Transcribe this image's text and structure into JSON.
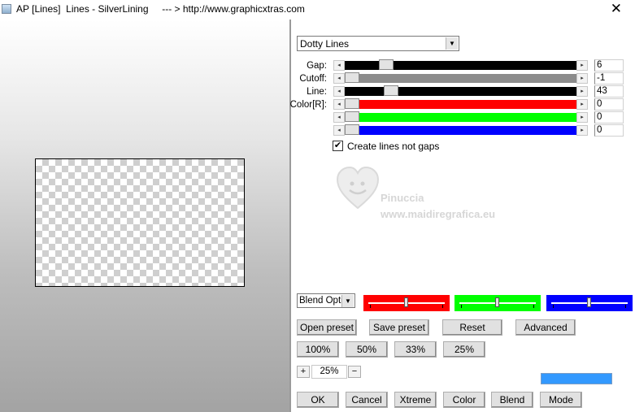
{
  "window": {
    "title": "AP [Lines]  Lines - SilverLining     --- > http://www.graphicxtras.com",
    "close": "✕"
  },
  "preset": {
    "selected": "Dotty Lines"
  },
  "params": [
    {
      "label": "Gap:",
      "value": "6"
    },
    {
      "label": "Cutoff:",
      "value": "-1"
    },
    {
      "label": "Line:",
      "value": "43"
    },
    {
      "label": "Color[R]:",
      "value": "0"
    },
    {
      "label": "",
      "value": "0"
    },
    {
      "label": "",
      "value": "0"
    }
  ],
  "colors": {
    "red": "#ff0000",
    "green": "#00ff00",
    "blue": "#0000ff",
    "swatch": "#3399ff"
  },
  "option": {
    "checked": true,
    "label": "Create lines not gaps"
  },
  "watermark": {
    "name": "Pinuccia",
    "url": "www.maidiregrafica.eu"
  },
  "blend": {
    "selected": "Blend Optio"
  },
  "buttons": {
    "open_preset": "Open preset",
    "save_preset": "Save preset",
    "reset": "Reset",
    "advanced": "Advanced",
    "z100": "100%",
    "z50": "50%",
    "z33": "33%",
    "z25": "25%",
    "ok": "OK",
    "cancel": "Cancel",
    "xtreme": "Xtreme",
    "color": "Color",
    "blend": "Blend",
    "mode": "Mode"
  },
  "zoom": {
    "plus": "+",
    "value": "25%",
    "minus": "−"
  }
}
